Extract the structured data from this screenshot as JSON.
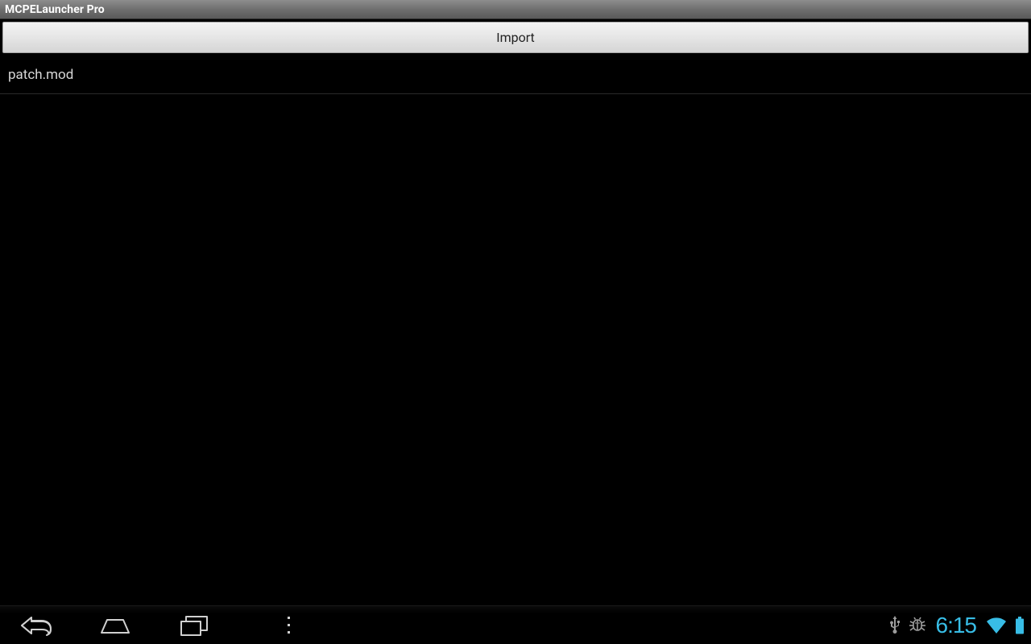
{
  "app": {
    "title": "MCPELauncher Pro"
  },
  "toolbar": {
    "import_label": "Import"
  },
  "list": {
    "items": [
      {
        "name": "patch.mod"
      }
    ]
  },
  "status": {
    "clock": "6:15"
  },
  "colors": {
    "holo_cyan": "#38bde6",
    "nav_icon": "#d0d0d0",
    "status_icon": "#9c9c9c"
  }
}
